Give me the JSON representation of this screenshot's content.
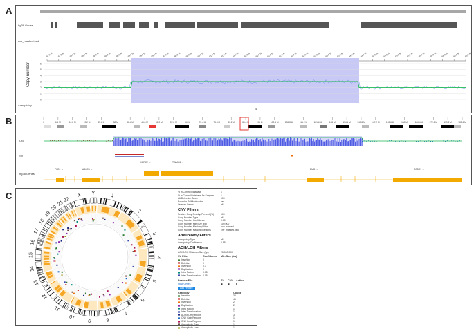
{
  "panels": {
    "a": "A",
    "b": "B",
    "c": "C"
  },
  "panel_a": {
    "track_genes": "hg38 Genes",
    "track_masked": "cnv_masked.bed",
    "y_axis_label": "Copy number",
    "y_ticks": [
      "6",
      "5",
      "4",
      "3",
      "2",
      "1",
      "0"
    ],
    "aneuploidy_label": "Aneuploidy",
    "aneuploidy_value": "4",
    "coordinate_labels": [
      "87.5 M",
      "87.8 M",
      "88.0 M",
      "88.3 M",
      "88.5 M",
      "88.8 M",
      "89.0 M",
      "89.3 M",
      "89.5 M",
      "89.8 M",
      "90.0 M",
      "90.3 M",
      "90.5 M",
      "90.8 M",
      "91.0 M",
      "91.3 M",
      "91.5 M",
      "91.8 M",
      "92.0 M",
      "92.3 M",
      "92.5 M",
      "92.8 M",
      "93.0 M",
      "93.3 M",
      "93.5 M",
      "93.8 M",
      "94.0 M",
      "94.3 M",
      "94.5 M",
      "94.8 M",
      "95.0 M",
      "95.3 M",
      "95.5 M",
      "95.8 M",
      "96.0 M",
      "96.3 M",
      "96.5 M"
    ],
    "highlight_color": "#c9c9f5",
    "line_color": "#1db954"
  },
  "panel_b": {
    "coordinate_labels": [
      "0",
      "6.4 M",
      "12.8 M",
      "19.2 M",
      "25.6 M",
      "32 M",
      "38.4 M",
      "44.8 M",
      "51.2 M",
      "57.6 M",
      "64 M",
      "70.4 M",
      "76.8 M",
      "83.2 M",
      "89.6 M",
      "96 M",
      "102.4 M",
      "108.8 M",
      "115.2 M",
      "121.6 M",
      "128 M",
      "134.4 M",
      "140.8 M",
      "147.2 M",
      "153.6 M",
      "160 M",
      "166.4 M",
      "172.8 M",
      "179.2 M",
      "185.6 M"
    ],
    "track_cn": "CN",
    "track_sv": "SV",
    "track_genes": "hg38 Genes",
    "gene_labels": [
      "PKD1 →",
      "ABCC6 →",
      "HERC2 →",
      "TTN-AS1 →",
      "DMD →",
      "CCDC1 →"
    ],
    "selection_color": "#e53935"
  },
  "panel_c": {
    "circos_chromosomes": [
      "1",
      "2",
      "3",
      "4",
      "5",
      "6",
      "7",
      "8",
      "9",
      "10",
      "11",
      "12",
      "13",
      "14",
      "15",
      "16",
      "17",
      "18",
      "19",
      "20",
      "21",
      "22",
      "X",
      "Y"
    ],
    "info_rows": [
      {
        "k": "% in Control Database",
        "v": "1"
      },
      {
        "k": "% in Control Database As Enzyme",
        "v": "1"
      },
      {
        "k": "Alt Detection Score",
        "v": "100"
      },
      {
        "k": "Found in Self Molecules",
        "v": "yes"
      },
      {
        "k": "Overlap Genes",
        "v": "all"
      }
    ],
    "cnv_filters_title": "CNV Filters",
    "cnv_rows": [
      {
        "k": "Feature Copy Overlap Percent (%)",
        "v": "100"
      },
      {
        "k": "Copy Number Type",
        "v": "all"
      },
      {
        "k": "Copy Number Confidence",
        "v": "0.00"
      },
      {
        "k": "Copy Number Min Size (bp)",
        "v": "100,000"
      },
      {
        "k": "Copy Number Masking Filter",
        "v": "non-masked"
      },
      {
        "k": "Copy Number Masking Regions",
        "v": "cnv_masked.bed"
      }
    ],
    "aneuploidy_filters_title": "Aneuploidy Filters",
    "aneuploidy_rows": [
      {
        "k": "Aneuploidy Type",
        "v": "all"
      },
      {
        "k": "Aneuploidy Confidence",
        "v": "0.95"
      }
    ],
    "aoh_title": "AOH/LOH Filters",
    "aoh_rows": [
      {
        "k": "AOH/LOH Minimum Size (bp)",
        "v": "25,000,000"
      }
    ],
    "sv_filter_header": [
      "SV Filter",
      "Confidence",
      "Min Size (bp)"
    ],
    "sv_filter_rows": [
      {
        "name": "Insertion",
        "conf": "0",
        "color": "#2e7d32"
      },
      {
        "name": "Deletion",
        "conf": "0",
        "color": "#c62828"
      },
      {
        "name": "Inversion",
        "conf": "0.7",
        "color": "#ef6c00"
      },
      {
        "name": "Duplication",
        "conf": "0",
        "color": "#8e24aa"
      },
      {
        "name": "Intra Fusion",
        "conf": "0.05",
        "color": "#00897b"
      },
      {
        "name": "Inter Translocation",
        "conf": "0.05",
        "color": "#3949ab"
      }
    ],
    "feature_file_header": [
      "Feature File",
      "SV",
      "CNV",
      "Action"
    ],
    "feature_file_name": "hg38 Genes",
    "add_feature_label": "Add Feature",
    "category_header": [
      "Category",
      "Count"
    ],
    "category_rows": [
      {
        "name": "Insertion",
        "count": "35",
        "color": "#2e7d32"
      },
      {
        "name": "Deletion",
        "count": "45",
        "color": "#c62828"
      },
      {
        "name": "Inversion",
        "count": "2",
        "color": "#ef6c00"
      },
      {
        "name": "Duplication",
        "count": "2",
        "color": "#8e24aa"
      },
      {
        "name": "Intra Fusion",
        "count": "1",
        "color": "#00897b"
      },
      {
        "name": "Inter Translocation",
        "count": "1",
        "color": "#3949ab"
      },
      {
        "name": "AOH/LOH Regions",
        "count": "3",
        "color": "#1a237e"
      },
      {
        "name": "CNV Gain Regions",
        "count": "1",
        "color": "#1565c0"
      },
      {
        "name": "CNV Loss Regions",
        "count": "1",
        "color": "#ad1457"
      },
      {
        "name": "Aneuploidy Gain",
        "count": "1",
        "color": "#6d4c41"
      },
      {
        "name": "Aneuploidy Loss",
        "count": "1",
        "color": "#9e9d24"
      }
    ]
  }
}
